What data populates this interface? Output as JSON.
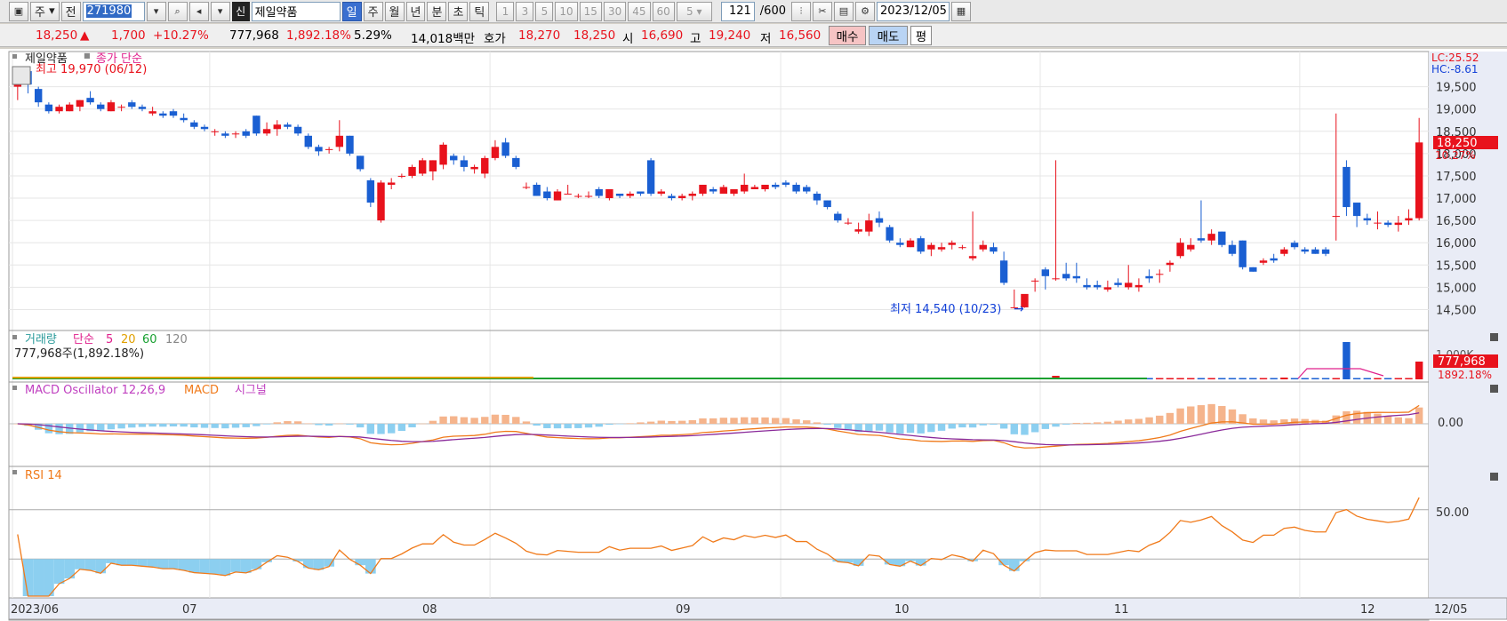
{
  "toolbar": {
    "type_label": "주",
    "prev_label": "전",
    "code": "271980",
    "stock_name": "제일약품",
    "sin_label": "신",
    "periods": [
      "일",
      "주",
      "월",
      "년",
      "분",
      "초",
      "틱"
    ],
    "active_period": "일",
    "intervals": [
      "1",
      "3",
      "5",
      "10",
      "15",
      "30",
      "45",
      "60"
    ],
    "interval_select": "5",
    "count_value": "121",
    "count_total": "/600",
    "date": "2023/12/05"
  },
  "quote": {
    "price": "18,250",
    "change": "1,700",
    "change_pct": "+10.27%",
    "volume": "777,968",
    "volume_pct": "1,892.18%",
    "turnover_pct": "5.29%",
    "amount": "14,018백만",
    "hoga_label": "호가",
    "ask": "18,270",
    "bid": "18,250",
    "open_label": "시",
    "open": "16,690",
    "high_label": "고",
    "high": "19,240",
    "low_label": "저",
    "low": "16,560",
    "buy_label": "매수",
    "sell_label": "매도",
    "eval_label": "평"
  },
  "price_panel": {
    "name": "제일약품",
    "overlay": "종가 단순",
    "max_note": "최고 19,970 (06/12)",
    "min_note": "최저 14,540 (10/23)",
    "lc": "LC:25.52",
    "hc": "HC:-8.61",
    "last_label": "18,250",
    "last_pct": "10.27%"
  },
  "volume_panel": {
    "title": "거래량",
    "ma_label": "단순",
    "ma": [
      "5",
      "20",
      "60",
      "120"
    ],
    "value": "777,968주(1,892.18%)",
    "axis_label": "1,000K",
    "last_label": "777,968",
    "last_pct": "1892.18%"
  },
  "macd_panel": {
    "title": "MACD Oscillator 12,26,9",
    "macd_label": "MACD",
    "signal_label": "시그널",
    "zero_label": "0.00"
  },
  "rsi_panel": {
    "title": "RSI 14",
    "mid_label": "50.00"
  },
  "colors": {
    "up": "#e8121c",
    "down": "#1a5fd2",
    "macd": "#f07a1a",
    "signal": "#8a2a9a",
    "osc_pos": "#f5b48c",
    "osc_neg": "#8ccff0",
    "rsi": "#f07a1a"
  },
  "chart_data": {
    "type": "candlestick",
    "x_axis_labels": [
      "2023/06",
      "07",
      "08",
      "09",
      "10",
      "11",
      "12",
      "12/05"
    ],
    "y_ticks": [
      14500,
      15000,
      15500,
      16000,
      16500,
      17000,
      17500,
      18000,
      18500,
      19000,
      19500
    ],
    "y_range": [
      14150,
      20250
    ],
    "candles": [
      [
        19500,
        19950,
        19200,
        19850
      ],
      [
        19850,
        19900,
        19350,
        19550
      ],
      [
        19450,
        19500,
        19050,
        19150
      ],
      [
        19100,
        19150,
        18900,
        18950
      ],
      [
        18950,
        19100,
        18900,
        19050
      ],
      [
        18950,
        19150,
        18950,
        19100
      ],
      [
        19050,
        19200,
        18950,
        19200
      ],
      [
        19250,
        19400,
        19100,
        19150
      ],
      [
        19100,
        19150,
        18950,
        19000
      ],
      [
        18950,
        19200,
        18950,
        19150
      ],
      [
        19050,
        19100,
        18950,
        19050
      ],
      [
        19150,
        19200,
        19000,
        19050
      ],
      [
        19050,
        19100,
        18950,
        19000
      ],
      [
        18900,
        19050,
        18850,
        18950
      ],
      [
        18900,
        18950,
        18800,
        18850
      ],
      [
        18950,
        19000,
        18800,
        18850
      ],
      [
        18800,
        18900,
        18700,
        18750
      ],
      [
        18700,
        18750,
        18550,
        18600
      ],
      [
        18600,
        18650,
        18500,
        18550
      ],
      [
        18500,
        18550,
        18400,
        18500
      ],
      [
        18450,
        18500,
        18350,
        18400
      ],
      [
        18450,
        18500,
        18350,
        18450
      ],
      [
        18500,
        18550,
        18350,
        18400
      ],
      [
        18850,
        18850,
        18400,
        18450
      ],
      [
        18450,
        18700,
        18400,
        18550
      ],
      [
        18550,
        18750,
        18400,
        18650
      ],
      [
        18650,
        18700,
        18550,
        18600
      ],
      [
        18600,
        18650,
        18400,
        18450
      ],
      [
        18400,
        18450,
        18100,
        18150
      ],
      [
        18150,
        18200,
        17950,
        18050
      ],
      [
        18100,
        18150,
        18000,
        18100
      ],
      [
        18150,
        18750,
        18050,
        18400
      ],
      [
        18400,
        18400,
        17950,
        18000
      ],
      [
        17950,
        17950,
        17600,
        17650
      ],
      [
        17400,
        17450,
        16800,
        16900
      ],
      [
        16500,
        17400,
        16450,
        17350
      ],
      [
        17300,
        17450,
        17200,
        17350
      ],
      [
        17500,
        17550,
        17450,
        17500
      ],
      [
        17500,
        17750,
        17450,
        17700
      ],
      [
        17550,
        17900,
        17500,
        17850
      ],
      [
        17600,
        17850,
        17400,
        17850
      ],
      [
        17750,
        18250,
        17650,
        18200
      ],
      [
        17950,
        18000,
        17750,
        17850
      ],
      [
        17850,
        17950,
        17600,
        17700
      ],
      [
        17650,
        17750,
        17550,
        17700
      ],
      [
        17550,
        17950,
        17450,
        17900
      ],
      [
        17900,
        18300,
        17850,
        18150
      ],
      [
        18250,
        18350,
        17900,
        17950
      ],
      [
        17900,
        17950,
        17650,
        17700
      ],
      [
        17250,
        17350,
        17200,
        17250
      ],
      [
        17300,
        17350,
        17050,
        17050
      ],
      [
        17150,
        17250,
        16950,
        17000
      ],
      [
        16950,
        17200,
        16950,
        17150
      ],
      [
        17100,
        17300,
        17100,
        17100
      ],
      [
        17050,
        17100,
        17000,
        17050
      ],
      [
        17050,
        17150,
        17000,
        17050
      ],
      [
        17200,
        17250,
        17000,
        17050
      ],
      [
        17000,
        17200,
        16950,
        17200
      ],
      [
        17100,
        17100,
        17000,
        17050
      ],
      [
        17050,
        17150,
        17000,
        17100
      ],
      [
        17150,
        17100,
        17050,
        17100
      ],
      [
        17850,
        17900,
        17050,
        17100
      ],
      [
        17100,
        17200,
        17050,
        17150
      ],
      [
        17050,
        17100,
        16950,
        17000
      ],
      [
        17000,
        17100,
        16950,
        17050
      ],
      [
        17050,
        17150,
        16950,
        17100
      ],
      [
        17100,
        17300,
        17050,
        17300
      ],
      [
        17200,
        17250,
        17100,
        17150
      ],
      [
        17100,
        17300,
        17100,
        17250
      ],
      [
        17100,
        17200,
        17050,
        17200
      ],
      [
        17150,
        17550,
        17100,
        17300
      ],
      [
        17200,
        17300,
        17200,
        17250
      ],
      [
        17200,
        17300,
        17150,
        17300
      ],
      [
        17300,
        17350,
        17200,
        17250
      ],
      [
        17350,
        17400,
        17250,
        17300
      ],
      [
        17300,
        17350,
        17100,
        17150
      ],
      [
        17250,
        17300,
        17100,
        17150
      ],
      [
        17100,
        17150,
        16850,
        16950
      ],
      [
        16950,
        16950,
        16750,
        16800
      ],
      [
        16650,
        16700,
        16450,
        16500
      ],
      [
        16450,
        16550,
        16400,
        16450
      ],
      [
        16250,
        16450,
        16200,
        16300
      ],
      [
        16250,
        16650,
        16150,
        16500
      ],
      [
        16550,
        16700,
        16350,
        16450
      ],
      [
        16350,
        16400,
        16000,
        16050
      ],
      [
        16000,
        16100,
        15900,
        15950
      ],
      [
        15900,
        16100,
        15900,
        16050
      ],
      [
        16100,
        16150,
        15750,
        15800
      ],
      [
        15850,
        16000,
        15700,
        15950
      ],
      [
        15850,
        16000,
        15800,
        15900
      ],
      [
        15950,
        16050,
        15850,
        16000
      ],
      [
        15900,
        15950,
        15850,
        15900
      ],
      [
        15650,
        16700,
        15600,
        15700
      ],
      [
        15850,
        16050,
        15800,
        15950
      ],
      [
        15900,
        16000,
        15750,
        15800
      ],
      [
        15600,
        15800,
        15050,
        15100
      ],
      [
        14540,
        14950,
        14540,
        14550
      ],
      [
        14550,
        14800,
        14540,
        14850
      ],
      [
        15150,
        15200,
        14900,
        15150
      ],
      [
        15400,
        15450,
        14950,
        15250
      ],
      [
        15200,
        17850,
        15150,
        15200
      ],
      [
        15300,
        15550,
        15150,
        15200
      ],
      [
        15250,
        15550,
        15100,
        15200
      ],
      [
        15050,
        15200,
        14950,
        15000
      ],
      [
        15050,
        15150,
        14950,
        15000
      ],
      [
        14950,
        15150,
        14900,
        15000
      ],
      [
        15100,
        15200,
        15000,
        15050
      ],
      [
        15000,
        15500,
        14950,
        15100
      ],
      [
        15000,
        15200,
        14900,
        15050
      ],
      [
        15250,
        15400,
        15100,
        15200
      ],
      [
        15300,
        15400,
        15100,
        15300
      ],
      [
        15500,
        15600,
        15350,
        15550
      ],
      [
        15700,
        16100,
        15650,
        16000
      ],
      [
        15850,
        16100,
        15800,
        15950
      ],
      [
        16100,
        16950,
        16000,
        16050
      ],
      [
        16050,
        16300,
        15950,
        16200
      ],
      [
        16250,
        16250,
        15900,
        15950
      ],
      [
        15950,
        16050,
        15700,
        15750
      ],
      [
        16050,
        16050,
        15400,
        15450
      ],
      [
        15450,
        15450,
        15350,
        15350
      ],
      [
        15550,
        15650,
        15500,
        15600
      ],
      [
        15650,
        15750,
        15550,
        15600
      ],
      [
        15750,
        15900,
        15700,
        15850
      ],
      [
        16000,
        16050,
        15850,
        15900
      ],
      [
        15850,
        15900,
        15750,
        15800
      ],
      [
        15850,
        15900,
        15750,
        15750
      ],
      [
        15850,
        15900,
        15700,
        15750
      ],
      [
        16600,
        18900,
        16050,
        16600
      ],
      [
        17700,
        17850,
        16600,
        16800
      ],
      [
        16900,
        16900,
        16350,
        16600
      ],
      [
        16550,
        16650,
        16400,
        16500
      ],
      [
        16450,
        16700,
        16300,
        16450
      ],
      [
        16450,
        16500,
        16350,
        16400
      ],
      [
        16400,
        16600,
        16250,
        16450
      ],
      [
        16500,
        16750,
        16400,
        16550
      ],
      [
        16550,
        18800,
        16500,
        18250
      ]
    ]
  }
}
